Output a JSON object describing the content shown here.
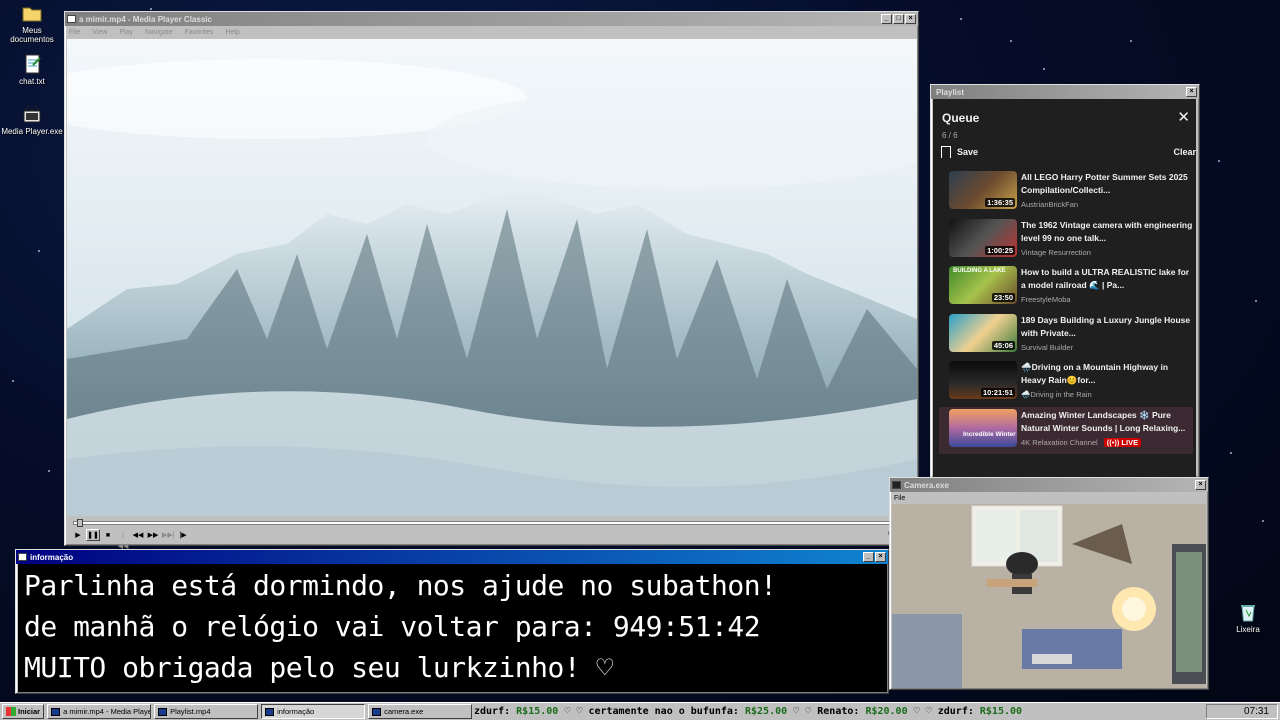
{
  "desktop": {
    "icons": [
      {
        "label": "Meus documentos",
        "icon": "folder-icon"
      },
      {
        "label": "chat.txt",
        "icon": "notepad-icon"
      },
      {
        "label": "Media Player.exe",
        "icon": "media-player-icon"
      },
      {
        "label": "Lixeira",
        "icon": "recycle-bin-icon"
      }
    ]
  },
  "player": {
    "title": "a mimir.mp4 - Media Player Classic",
    "menu": [
      "File",
      "View",
      "Play",
      "Navigate",
      "Favorites",
      "Help"
    ],
    "progress": 0.003
  },
  "playlist": {
    "window_title": "Playlist",
    "heading": "Queue",
    "count": "6 / 6",
    "save_label": "Save",
    "clear_label": "Clear",
    "items": [
      {
        "title": "All LEGO Harry Potter Summer Sets 2025 Compilation/Collecti...",
        "channel": "AustrianBrickFan",
        "duration": "1:36:35"
      },
      {
        "title": "The 1962 Vintage camera with engineering level 99 no one talk...",
        "channel": "Vintage Resurrection",
        "duration": "1:00:25"
      },
      {
        "title": "How to build a ULTRA REALISTIC lake for a model railroad 🌊 | Pa...",
        "channel": "FreestyleMoba",
        "duration": "23:50",
        "thumb_text": "BUILDING A LAKE"
      },
      {
        "title": "189 Days Building a Luxury Jungle House with Private...",
        "channel": "Survival Builder",
        "duration": "45:06"
      },
      {
        "title": "🌧️Driving on a Mountain Highway in Heavy Rain😊for...",
        "channel": "🌧️Driving in the Rain",
        "duration": "10:21:51"
      },
      {
        "title": "Amazing Winter Landscapes ❄️ Pure Natural Winter Sounds | Long Relaxing...",
        "channel": "4K Relaxation Channel",
        "live_label": "((•)) LIVE",
        "thumb_text": "Incredible Winter"
      }
    ]
  },
  "info": {
    "window_title": "informação",
    "lines": [
      "Parlinha está dormindo, nos ajude no subathon!",
      "de manhã o relógio vai voltar para:  949:51:42",
      "MUITO obrigada pelo seu lurkzinho! ♡"
    ]
  },
  "camera": {
    "title": "Camera.exe",
    "menu": "File"
  },
  "taskbar": {
    "start_label": "Iniciar",
    "items": [
      "a mimir.mp4 - Media Playe...",
      "Playlist.mp4",
      "informação",
      "camera.exe"
    ],
    "ticker": [
      {
        "name": "zdurf:",
        "amount": "R$15.00"
      },
      {
        "name": "certamente nao o bufunfa:",
        "amount": "R$25.00"
      },
      {
        "name": "Renato:",
        "amount": "R$20.00"
      },
      {
        "name": "zdurf:",
        "amount": "R$15.00"
      }
    ],
    "clock": "07:31"
  }
}
